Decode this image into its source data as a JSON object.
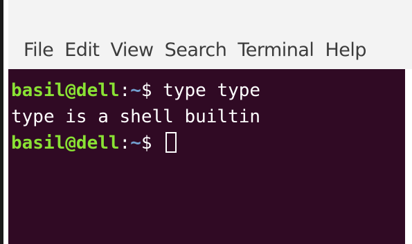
{
  "menu": {
    "items": [
      "File",
      "Edit",
      "View",
      "Search",
      "Terminal",
      "Help"
    ]
  },
  "terminal": {
    "lines": [
      {
        "user_host": "basil@dell",
        "sep": ":",
        "path": "~",
        "prompt": "$ ",
        "command": "type type"
      },
      {
        "output": "type is a shell builtin"
      },
      {
        "user_host": "basil@dell",
        "sep": ":",
        "path": "~",
        "prompt": "$ ",
        "command": ""
      }
    ]
  },
  "colors": {
    "terminal_bg": "#300a24",
    "prompt_user": "#8ae234",
    "prompt_path": "#729fcf",
    "text": "#ffffff"
  }
}
